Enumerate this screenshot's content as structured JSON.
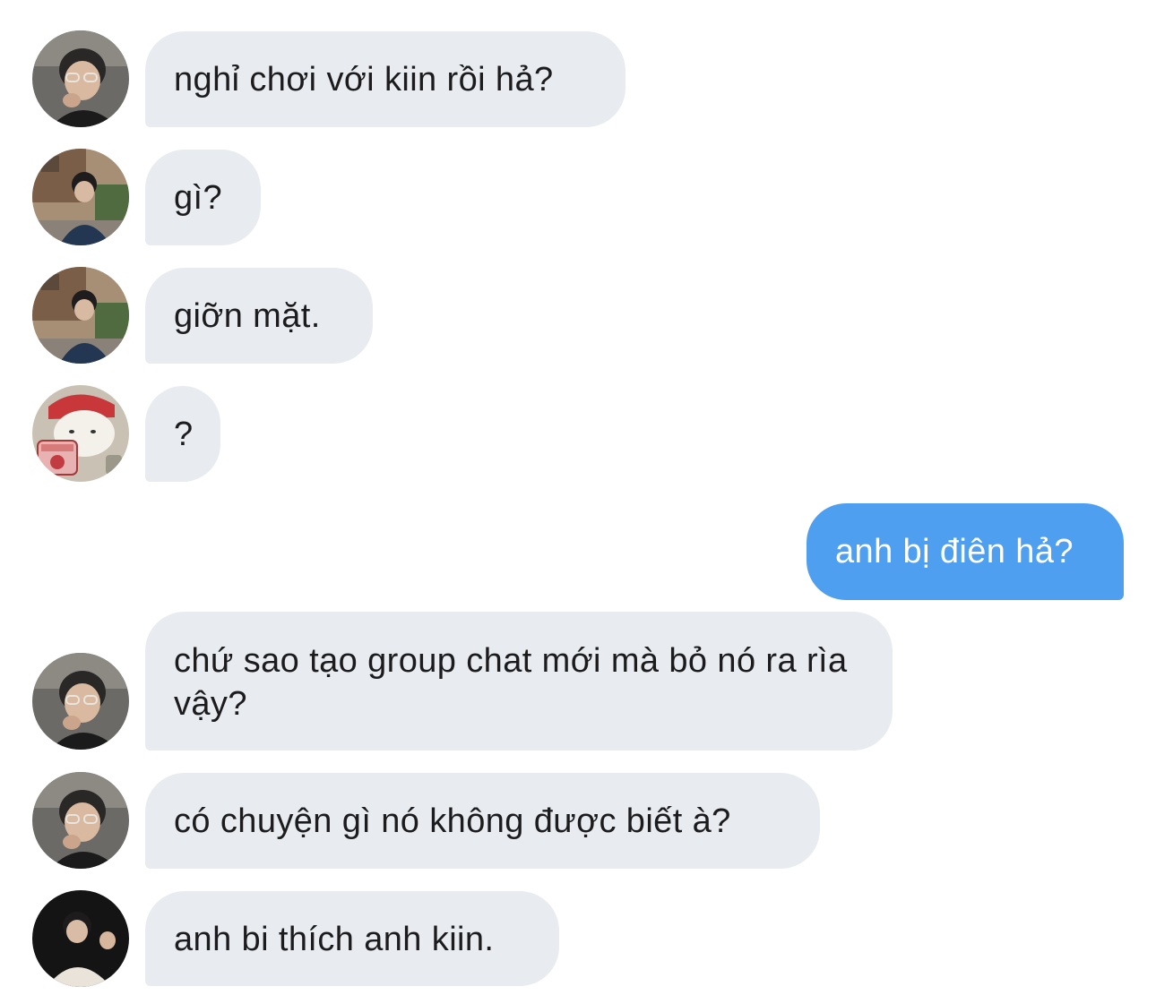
{
  "conversation": {
    "messages": [
      {
        "sender": "user-a",
        "direction": "incoming",
        "text": "nghỉ chơi với kiin rồi hả?",
        "avatar": "avatar-photo-glasses"
      },
      {
        "sender": "user-b",
        "direction": "incoming",
        "text": "gì?",
        "avatar": "avatar-photo-street"
      },
      {
        "sender": "user-b",
        "direction": "incoming",
        "text": "giỡn mặt.",
        "avatar": "avatar-photo-street"
      },
      {
        "sender": "user-c",
        "direction": "incoming",
        "text": "?",
        "avatar": "avatar-cartoon-bear"
      },
      {
        "sender": "me",
        "direction": "outgoing",
        "text": "anh bị điên hả?"
      },
      {
        "sender": "user-a",
        "direction": "incoming",
        "text": "chứ sao tạo group chat mới mà bỏ nó ra rìa vậy?",
        "avatar": "avatar-photo-glasses"
      },
      {
        "sender": "user-a",
        "direction": "incoming",
        "text": "có chuyện gì nó không được biết à?",
        "avatar": "avatar-photo-glasses"
      },
      {
        "sender": "user-d",
        "direction": "incoming",
        "text": "anh bi thích anh kiin.",
        "avatar": "avatar-photo-dark"
      }
    ]
  },
  "colors": {
    "incoming_bubble": "#e8ebef",
    "outgoing_bubble": "#4f9ff0",
    "incoming_text": "#1c1c1e",
    "outgoing_text": "#ffffff",
    "background": "#ffffff"
  }
}
